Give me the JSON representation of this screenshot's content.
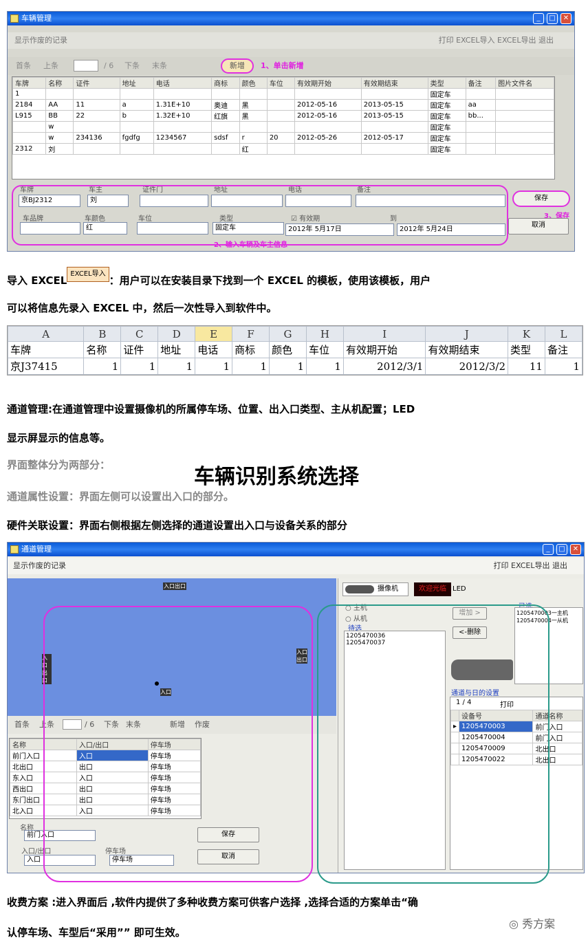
{
  "win1": {
    "title": "车辆管理",
    "menu_left": "显示作废的记录",
    "menu_right": "打印   EXCEL导入   EXCEL导出   退出",
    "nav": [
      "首条",
      "上条",
      "/ 6",
      "下条",
      "末条"
    ],
    "new_btn": "新增",
    "step1": "1、单击新增",
    "columns": [
      "车牌",
      "名称",
      "证件",
      "地址",
      "电话",
      "商标",
      "颜色",
      "车位",
      "有效期开始",
      "有效期结束",
      "类型",
      "备注",
      "图片文件名"
    ],
    "rows": [
      [
        "1",
        "",
        "",
        "",
        "",
        "",
        "",
        "",
        "",
        "",
        "固定车",
        "",
        ""
      ],
      [
        "2184",
        "AA",
        "11",
        "a",
        "1.31E+10",
        "奥迪",
        "黑",
        "",
        "2012-05-16",
        "2013-05-15",
        "固定车",
        "aa",
        ""
      ],
      [
        "L915",
        "BB",
        "22",
        "b",
        "1.32E+10",
        "红旗",
        "黑",
        "",
        "2012-05-16",
        "2013-05-15",
        "固定车",
        "bb...",
        ""
      ],
      [
        "",
        "w",
        "",
        "",
        "",
        "",
        "",
        "",
        "",
        "",
        "固定车",
        "",
        ""
      ],
      [
        "",
        "w",
        "234136",
        "fgdfg",
        "1234567",
        "sdsf",
        "r",
        "20",
        "2012-05-26",
        "2012-05-17",
        "固定车",
        "",
        ""
      ],
      [
        "2312",
        "刘",
        "",
        "",
        "",
        "",
        "红",
        "",
        "",
        "",
        "固定车",
        "",
        ""
      ]
    ],
    "form": {
      "plate_label": "车牌",
      "plate_value": "京BJ2312",
      "owner_label": "车主",
      "owner_value": "刘",
      "id_label": "证件门",
      "addr_label": "地址",
      "phone_label": "电话",
      "note_label": "备注",
      "brand_label": "车品牌",
      "color_label": "车颜色",
      "color_value": "红",
      "slot_label": "车位",
      "type_label": "类型",
      "type_value": "固定车",
      "valid_label": "有效期",
      "to_label": "到",
      "start_date": "2012年 5月17日",
      "end_date": "2012年 5月24日",
      "save": "保存",
      "cancel": "取消",
      "step2": "2、输入车辆及车主信息",
      "step3": "3、保存"
    }
  },
  "para1": {
    "a": "导入 EXCEL",
    "badge": "EXCEL导入",
    "b": "：用户可以在安装目录下找到一个 EXCEL 的模板，使用该模板，用户",
    "c": "可以将信息先录入 EXCEL 中，然后一次性导入到软件中。"
  },
  "excel": {
    "cols": [
      "A",
      "B",
      "C",
      "D",
      "E",
      "F",
      "G",
      "H",
      "I",
      "J",
      "K",
      "L"
    ],
    "header": [
      "车牌",
      "名称",
      "证件",
      "地址",
      "电话",
      "商标",
      "颜色",
      "车位",
      "有效期开始",
      "有效期结束",
      "类型",
      "备注"
    ],
    "row": [
      "京J37415",
      "1",
      "1",
      "1",
      "1",
      "1",
      "1",
      "1",
      "2012/3/1",
      "2012/3/2",
      "11",
      "1"
    ]
  },
  "para2": {
    "a": "通道管理:在通道管理中设置摄像机的所属停车场、位置、出入口类型、主从机配置；LED",
    "b": "显示屏显示的信息等。"
  },
  "para3": {
    "a": "界面整体分为两部分：",
    "heading": "车辆识别系统选择",
    "b": "通道属性设置：界面左侧可以设置出入口的部分。",
    "c": "硬件关联设置：界面右侧根据左侧选择的通道设置出入口与设备关系的部分"
  },
  "win2": {
    "title": "通道管理",
    "menu_left": "显示作废的记录",
    "menu_right": "打印  EXCEL导出  退出",
    "map_labels": [
      "入口出口",
      "入口出口",
      "入口出口",
      "入口"
    ],
    "nav": [
      "首条",
      "上条",
      "/ 6",
      "下条",
      "末条",
      "新增",
      "作废"
    ],
    "columns": [
      "名称",
      "入口/出口",
      "停车场"
    ],
    "rows": [
      [
        "前门入口",
        "入口",
        "停车场"
      ],
      [
        "北出口",
        "出口",
        "停车场"
      ],
      [
        "东入口",
        "入口",
        "停车场"
      ],
      [
        "西出口",
        "出口",
        "停车场"
      ],
      [
        "东门出口",
        "出口",
        "停车场"
      ],
      [
        "北入口",
        "入口",
        "停车场"
      ]
    ],
    "form": {
      "name_label": "名称",
      "name_value": "前门入口",
      "io_label": "入口/出口",
      "io_value": "入口",
      "lot_label": "停车场",
      "lot_value": "停车场",
      "save": "保存",
      "cancel": "取消"
    },
    "tabs": [
      "摄像机",
      "LED"
    ],
    "led_text": "欢迎光临",
    "radio_main": "主机",
    "radio_sub": "从机",
    "pending": "待选",
    "pending_items": [
      "1205470036",
      "1205470037"
    ],
    "add": "增加 >",
    "del": "<-删除",
    "selected": "已选",
    "selected_items": [
      "1205470003一主机",
      "1205470004一从机"
    ],
    "relation": "通道与日的设置",
    "pager": "1   / 4",
    "print": "打印",
    "rcols": [
      "设备号",
      "通道名称"
    ],
    "rrows": [
      [
        "1205470003",
        "前门入口"
      ],
      [
        "1205470004",
        "前门入口"
      ],
      [
        "1205470009",
        "北出口"
      ],
      [
        "1205470022",
        "北出口"
      ]
    ]
  },
  "para4": {
    "a": "收费方案 :进入界面后 ,软件内提供了多种收费方案可供客户选择 ,选择合适的方案单击“确",
    "b": "认停车场、车型后“采用”” 即可生效。"
  },
  "watermark": "秀方案"
}
